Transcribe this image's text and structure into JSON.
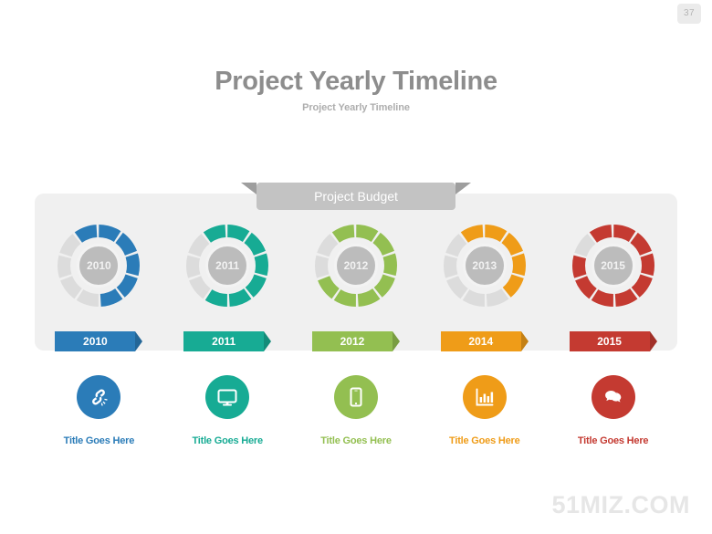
{
  "page": {
    "number": "37",
    "watermark": "51MIZ.COM",
    "background_color": "#ffffff"
  },
  "header": {
    "title": "Project Yearly Timeline",
    "subtitle": "Project Yearly Timeline",
    "title_color": "#8d8d8d",
    "subtitle_color": "#aeaeae"
  },
  "ribbon": {
    "label": "Project Budget",
    "fill_color": "#c3c3c3",
    "flange_color": "#9e9e9e"
  },
  "panel": {
    "fill_color": "#f0f0f0"
  },
  "chart_data": {
    "type": "pie",
    "title": "Project Budget",
    "segments_total": 10,
    "track_color": "#dcdcdc",
    "hub_color": "#bcbcbc",
    "series": [
      {
        "name": "2010",
        "hub_label": "2010",
        "tag_label": "2010",
        "color": "#2b7cb8",
        "filled_segments": 6,
        "value_percent": 60,
        "caption": "Title Goes Here",
        "icon": "broken-link-icon"
      },
      {
        "name": "2011",
        "hub_label": "2011",
        "tag_label": "2011",
        "color": "#17ab94",
        "filled_segments": 7,
        "value_percent": 70,
        "caption": "Title Goes Here",
        "icon": "monitor-icon"
      },
      {
        "name": "2012",
        "hub_label": "2012",
        "tag_label": "2012",
        "color": "#93bf51",
        "filled_segments": 8,
        "value_percent": 80,
        "caption": "Title Goes Here",
        "icon": "smartphone-icon"
      },
      {
        "name": "2013",
        "hub_label": "2013",
        "tag_label": "2014",
        "color": "#ef9c18",
        "filled_segments": 5,
        "value_percent": 50,
        "caption": "Title Goes Here",
        "icon": "bar-chart-icon"
      },
      {
        "name": "2015",
        "hub_label": "2015",
        "tag_label": "2015",
        "color": "#c43a31",
        "filled_segments": 9,
        "value_percent": 90,
        "caption": "Title Goes Here",
        "icon": "chat-bubbles-icon"
      }
    ]
  }
}
